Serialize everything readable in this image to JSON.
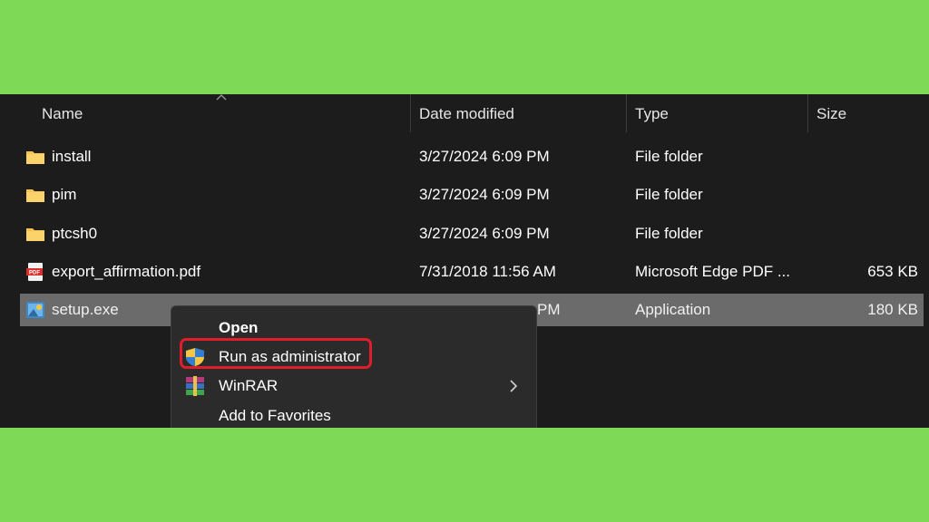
{
  "columns": {
    "name": "Name",
    "date_modified": "Date modified",
    "type": "Type",
    "size": "Size"
  },
  "files": [
    {
      "name": "install",
      "date": "3/27/2024 6:09 PM",
      "type": "File folder",
      "size": "",
      "icon": "folder-icon"
    },
    {
      "name": "pim",
      "date": "3/27/2024 6:09 PM",
      "type": "File folder",
      "size": "",
      "icon": "folder-icon"
    },
    {
      "name": "ptcsh0",
      "date": "3/27/2024 6:09 PM",
      "type": "File folder",
      "size": "",
      "icon": "folder-icon"
    },
    {
      "name": "export_affirmation.pdf",
      "date": "7/31/2018 11:56 AM",
      "type": "Microsoft Edge PDF ...",
      "size": "653 KB",
      "icon": "pdf-icon"
    },
    {
      "name": "setup.exe",
      "date": "PM",
      "type": "Application",
      "size": "180 KB",
      "icon": "installer-icon",
      "selected": true
    }
  ],
  "context_menu": {
    "items": [
      {
        "label": "Open",
        "bold": true
      },
      {
        "label": "Run as administrator",
        "icon": "uac-shield-icon",
        "highlighted": true
      },
      {
        "label": "WinRAR",
        "icon": "winrar-icon",
        "submenu": true
      },
      {
        "label": "Add to Favorites"
      }
    ]
  },
  "colors": {
    "background": "#7ed957",
    "explorer_bg": "#1c1c1c",
    "menu_bg": "#2b2b2b",
    "selection": "#6b6b6b",
    "highlight_border": "#e01e2b",
    "folder": "#f8c44f"
  }
}
